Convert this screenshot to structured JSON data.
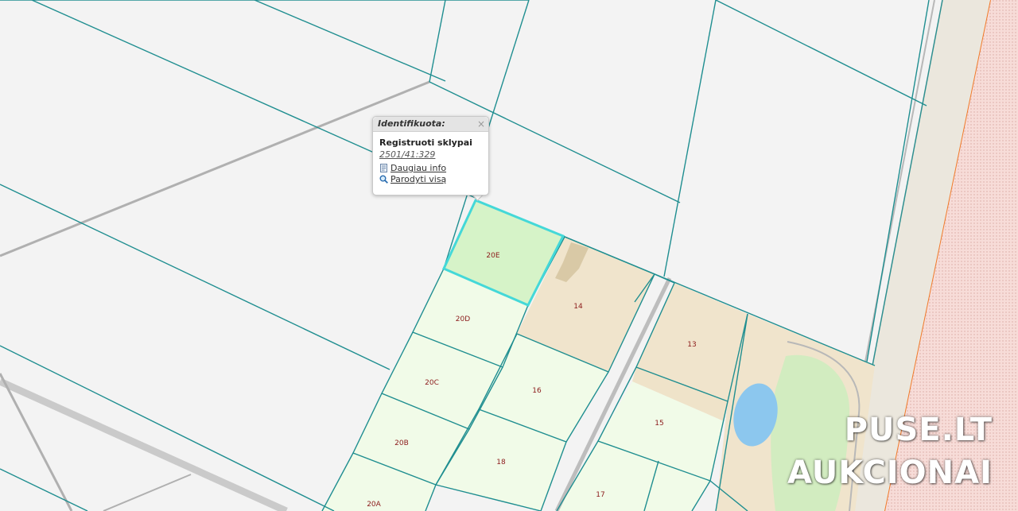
{
  "popup": {
    "title": "Identifikuota:",
    "close_symbol": "×",
    "layer": "Registruoti sklypai",
    "parcel_id": "2501/41:329",
    "more_info_label": "Daugiau info",
    "show_all_label": "Parodyti visą",
    "icons": [
      "document-info-icon",
      "magnifier-icon"
    ]
  },
  "parcels": [
    {
      "label": "20E",
      "selected": true
    },
    {
      "label": "20D"
    },
    {
      "label": "20C"
    },
    {
      "label": "20B"
    },
    {
      "label": "20A"
    },
    {
      "label": "14"
    },
    {
      "label": "13"
    },
    {
      "label": "16"
    },
    {
      "label": "15"
    },
    {
      "label": "18"
    },
    {
      "label": "17"
    }
  ],
  "watermark": {
    "line1": "PUSE.LT",
    "line2": "AUKCIONAI"
  },
  "colors": {
    "background": "#f3f3f3",
    "parcel_border": "#1f8e90",
    "selected_border": "#44d8d8",
    "selected_fill": "#d6f3c8",
    "parcel_fill": "#f1fbe8",
    "built_fill": "#f0e4cc",
    "water": "#8cc7ee",
    "green_area": "#d2ecc0",
    "zone_fill": "#f6d9d5",
    "zone_border": "#f07a2a",
    "road": "#a8a8a8",
    "label": "#8b1a1a"
  }
}
